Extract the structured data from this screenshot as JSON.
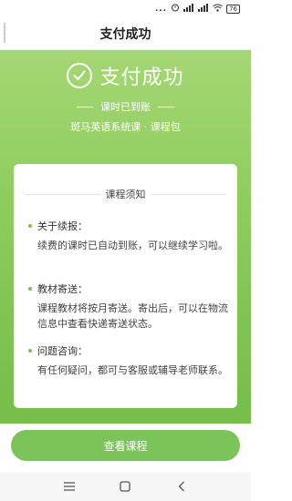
{
  "status_bar": {
    "dots": "...",
    "battery": "76"
  },
  "header": {
    "title": "支付成功"
  },
  "success": {
    "title": "支付成功",
    "subtitle": "课时已到账",
    "course_name": "斑马英语系统课 · 课程包"
  },
  "notice": {
    "title": "课程须知",
    "items": [
      {
        "heading": "关于续报：",
        "text": "续费的课时已自动到账，可以继续学习啦。"
      },
      {
        "heading": "教材寄送：",
        "text": "课程教材将按月寄送。寄出后，可以在物流信息中查看快递寄送状态。"
      },
      {
        "heading": "问题咨询：",
        "text": "有任何疑问，都可与客服或辅导老师联系。"
      }
    ]
  },
  "actions": {
    "view_course": "查看课程"
  },
  "colors": {
    "green_top": "#a5d774",
    "green_bottom": "#76bd4a",
    "button": "#7cc35a"
  },
  "icons": {
    "status": [
      "alarm-icon",
      "signal-icon",
      "wifi-icon",
      "battery-icon"
    ],
    "success": "check-circle-icon",
    "system_nav": [
      "menu-icon",
      "home-icon",
      "back-icon"
    ]
  }
}
